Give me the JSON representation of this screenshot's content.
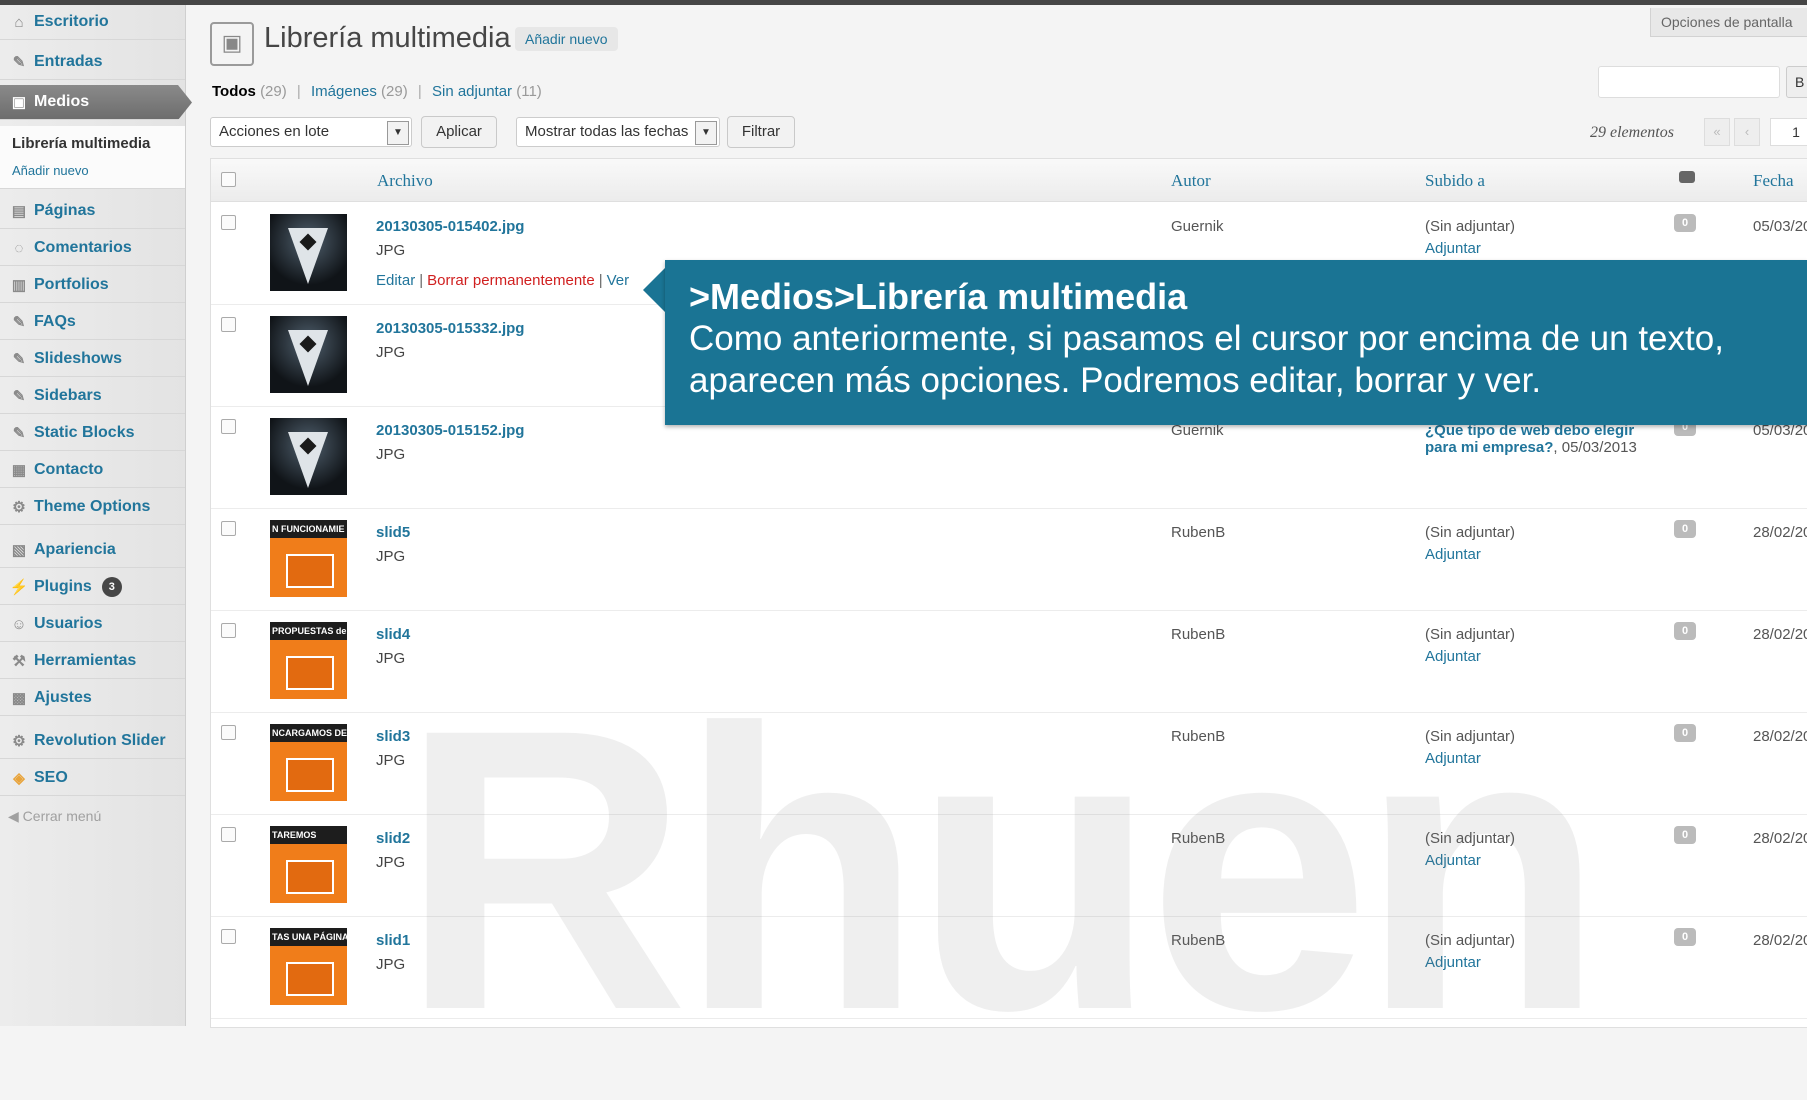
{
  "sidebar": {
    "items": [
      {
        "label": "Escritorio",
        "icon": "home-icon"
      },
      {
        "label": "Entradas",
        "icon": "pin-icon"
      },
      {
        "label": "Medios",
        "icon": "media-icon"
      },
      {
        "label": "Páginas",
        "icon": "pages-icon"
      },
      {
        "label": "Comentarios",
        "icon": "comments-icon"
      },
      {
        "label": "Portfolios",
        "icon": "portfolio-icon"
      },
      {
        "label": "FAQs",
        "icon": "pin-icon"
      },
      {
        "label": "Slideshows",
        "icon": "pin-icon"
      },
      {
        "label": "Sidebars",
        "icon": "pin-icon"
      },
      {
        "label": "Static Blocks",
        "icon": "pin-icon"
      },
      {
        "label": "Contacto",
        "icon": "contact-icon"
      },
      {
        "label": "Theme Options",
        "icon": "gear-icon"
      },
      {
        "label": "Apariencia",
        "icon": "appearance-icon"
      },
      {
        "label": "Plugins",
        "icon": "plugin-icon",
        "badge": "3"
      },
      {
        "label": "Usuarios",
        "icon": "users-icon"
      },
      {
        "label": "Herramientas",
        "icon": "tools-icon"
      },
      {
        "label": "Ajustes",
        "icon": "settings-icon"
      },
      {
        "label": "Revolution Slider",
        "icon": "gear-icon"
      },
      {
        "label": "SEO",
        "icon": "seo-icon"
      }
    ],
    "submenu": {
      "current": "Librería multimedia",
      "add": "Añadir nuevo"
    },
    "collapse": "Cerrar menú"
  },
  "header": {
    "title": "Librería multimedia",
    "add_new": "Añadir nuevo",
    "screen_options": "Opciones de pantalla",
    "search_button": "B"
  },
  "filters": {
    "all": "Todos",
    "all_count": "(29)",
    "images": "Imágenes",
    "images_count": "(29)",
    "unattached": "Sin adjuntar",
    "unattached_count": "(11)"
  },
  "toolbar": {
    "bulk": "Acciones en lote",
    "apply": "Aplicar",
    "dates": "Mostrar todas las fechas",
    "filter": "Filtrar",
    "count": "29 elementos",
    "first": "«",
    "prev": "‹",
    "page": "1"
  },
  "table": {
    "headers": {
      "file": "Archivo",
      "author": "Autor",
      "uploaded": "Subido a",
      "date": "Fecha"
    },
    "rows": [
      {
        "name": "20130305-015402.jpg",
        "type": "JPG",
        "author": "Guernik",
        "attached": "(Sin adjuntar)",
        "attach_link": "Adjuntar",
        "comments": "0",
        "date": "05/03/20",
        "thumb_text": ""
      },
      {
        "name": "20130305-015332.jpg",
        "type": "JPG",
        "author": "",
        "attached": "",
        "attach_link": "",
        "comments": "",
        "date": "",
        "thumb_text": ""
      },
      {
        "name": "20130305-015152.jpg",
        "type": "JPG",
        "author": "Guernik",
        "attached": "¿Que tipo de web debo elegir para mi empresa?",
        "attach_link": ", 05/03/2013",
        "comments": "0",
        "date": "05/03/20",
        "thumb_text": ""
      },
      {
        "name": "slid5",
        "type": "JPG",
        "author": "RubenB",
        "attached": "(Sin adjuntar)",
        "attach_link": "Adjuntar",
        "comments": "0",
        "date": "28/02/20",
        "thumb_text": "N FUNCIONAMIE"
      },
      {
        "name": "slid4",
        "type": "JPG",
        "author": "RubenB",
        "attached": "(Sin adjuntar)",
        "attach_link": "Adjuntar",
        "comments": "0",
        "date": "28/02/20",
        "thumb_text": "PROPUESTAS de"
      },
      {
        "name": "slid3",
        "type": "JPG",
        "author": "RubenB",
        "attached": "(Sin adjuntar)",
        "attach_link": "Adjuntar",
        "comments": "0",
        "date": "28/02/20",
        "thumb_text": "NCARGAMOS DE"
      },
      {
        "name": "slid2",
        "type": "JPG",
        "author": "RubenB",
        "attached": "(Sin adjuntar)",
        "attach_link": "Adjuntar",
        "comments": "0",
        "date": "28/02/20",
        "thumb_text": "TAREMOS"
      },
      {
        "name": "slid1",
        "type": "JPG",
        "author": "RubenB",
        "attached": "(Sin adjuntar)",
        "attach_link": "Adjuntar",
        "comments": "0",
        "date": "28/02/20",
        "thumb_text": "TAS UNA PÁGINA"
      }
    ],
    "row_actions": {
      "edit": "Editar",
      "delete": "Borrar permanentemente",
      "view": "Ver",
      "sep": "|"
    }
  },
  "callout": {
    "title": ">Medios>Librería multimedia",
    "text": "Como anteriormente, si pasamos el cursor por encima de un texto, aparecen más opciones. Podremos editar, borrar y ver."
  },
  "watermark": "Rhuen",
  "colors": {
    "link": "#21759b",
    "callout": "#1a7494",
    "danger": "#d02020",
    "thumb_orange": "#f07d1a"
  }
}
